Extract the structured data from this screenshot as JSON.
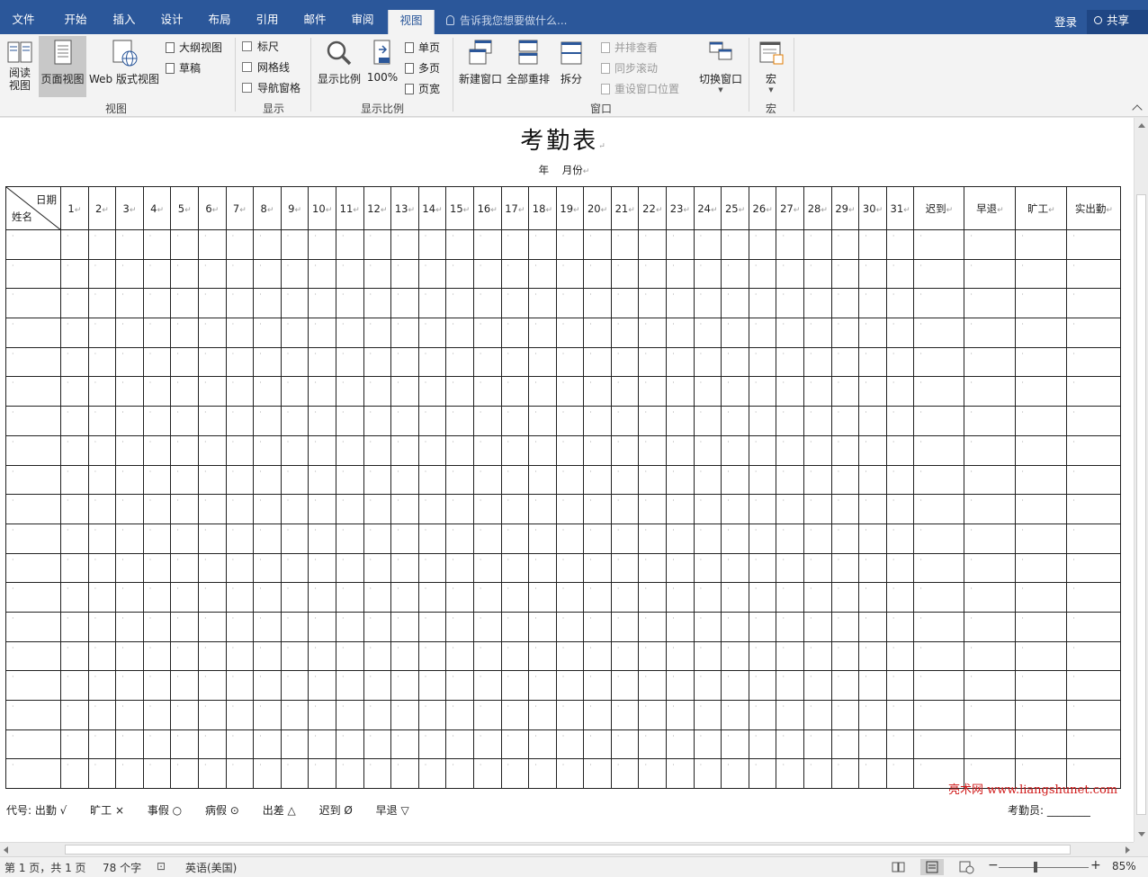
{
  "tabs": [
    "文件",
    "开始",
    "插入",
    "设计",
    "布局",
    "引用",
    "邮件",
    "审阅",
    "视图"
  ],
  "active_tab": "视图",
  "tellme_placeholder": "告诉我您想要做什么...",
  "login": "登录",
  "share": "共享",
  "ribbon": {
    "views": {
      "read_mode": [
        "阅读",
        "视图"
      ],
      "print_layout": "页面视图",
      "web_layout": "Web 版式视图",
      "outline": "大纲视图",
      "draft": "草稿",
      "label": "视图"
    },
    "show": {
      "ruler": "标尺",
      "gridlines": "网格线",
      "nav_pane": "导航窗格",
      "label": "显示"
    },
    "zoom": {
      "zoom": "显示比例",
      "hundred": "100%",
      "one_page": "单页",
      "multi_page": "多页",
      "page_width": "页宽",
      "label": "显示比例"
    },
    "window": {
      "new_window": "新建窗口",
      "arrange_all": "全部重排",
      "split": "拆分",
      "side_by_side": "并排查看",
      "sync_scroll": "同步滚动",
      "reset_pos": "重设窗口位置",
      "switch_window": "切换窗口",
      "label": "窗口"
    },
    "macros": {
      "macros": "宏",
      "label": "宏"
    }
  },
  "document": {
    "title": "考勤表",
    "subtitle": "年    月份",
    "header_date": "日期",
    "header_name": "姓名",
    "days": [
      "1",
      "2",
      "3",
      "4",
      "5",
      "6",
      "7",
      "8",
      "9",
      "10",
      "11",
      "12",
      "13",
      "14",
      "15",
      "16",
      "17",
      "18",
      "19",
      "20",
      "21",
      "22",
      "23",
      "24",
      "25",
      "26",
      "27",
      "28",
      "29",
      "30",
      "31"
    ],
    "summary_cols": [
      "迟到",
      "早退",
      "旷工",
      "实出勤"
    ],
    "row_count": 19,
    "legend": [
      "代号: 出勤 √",
      "旷工 ×",
      "事假 ○",
      "病假 ⊙",
      "出差 △",
      "迟到 Ø",
      "早退 ▽"
    ],
    "clerk": "考勤员: ________",
    "watermark": "亮术网 www.liangshunet.com"
  },
  "status": {
    "page": "第 1 页，共 1 页",
    "words": "78 个字",
    "language": "英语(美国)",
    "zoom": "85%"
  }
}
